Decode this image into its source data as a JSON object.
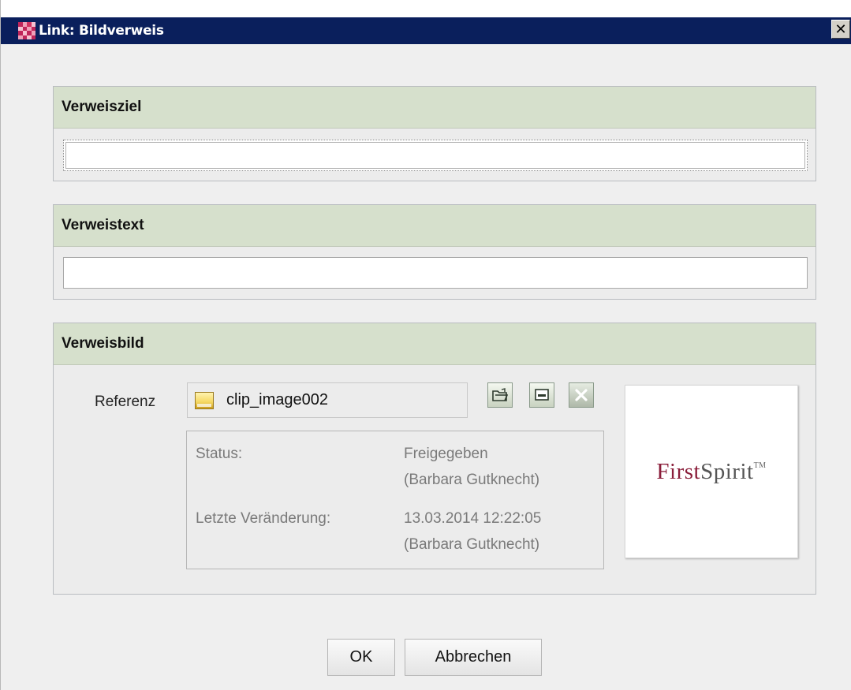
{
  "window": {
    "title": "Link: Bildverweis",
    "close_symbol": "✕"
  },
  "groups": {
    "target": {
      "title": "Verweisziel",
      "value": ""
    },
    "text": {
      "title": "Verweistext",
      "value": ""
    },
    "image": {
      "title": "Verweisbild",
      "reference_label": "Referenz",
      "reference_value": "clip_image002",
      "info": [
        {
          "key": "Status:",
          "value": "Freigegeben",
          "value2": "(Barbara Gutknecht)"
        },
        {
          "key": "Letzte Veränderung:",
          "value": "13.03.2014 12:22:05",
          "value2": "(Barbara Gutknecht)"
        }
      ],
      "preview_logo": {
        "part1": "First",
        "part2": "Spirit",
        "tm": "TM"
      },
      "icons": [
        "open-folder-icon",
        "show-icon",
        "remove-icon"
      ]
    }
  },
  "buttons": {
    "ok": "OK",
    "cancel": "Abbrechen"
  },
  "colors": {
    "titlebar": "#0a1f5c",
    "group_header": "#d6e0cc",
    "logo_accent": "#8a1d3a"
  }
}
